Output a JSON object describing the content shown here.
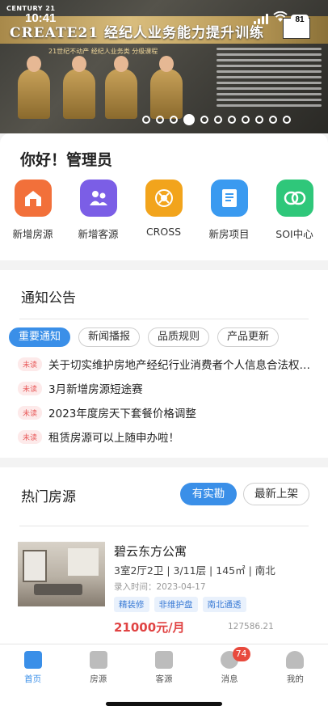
{
  "status": {
    "time": "10:41",
    "battery": "81"
  },
  "banner": {
    "brand": "CENTURY 21",
    "title": "CREATE21 经纪人业务能力提升训练",
    "subtitle": "21世纪不动产 经纪人业务类 分级课程",
    "slide_count": 11,
    "active_slide": 3
  },
  "greeting": "你好！管理员",
  "apps": [
    {
      "label": "新增房源",
      "icon": "house-add-icon",
      "color": "#f2703a"
    },
    {
      "label": "新增客源",
      "icon": "customer-add-icon",
      "color": "#7b5ee6"
    },
    {
      "label": "CROSS",
      "icon": "cross-icon",
      "color": "#f2a41c"
    },
    {
      "label": "新房项目",
      "icon": "new-project-icon",
      "color": "#3a9af0"
    },
    {
      "label": "SOI中心",
      "icon": "soi-center-icon",
      "color": "#2fc77a"
    }
  ],
  "notices": {
    "title": "通知公告",
    "tabs": [
      "重要通知",
      "新闻播报",
      "品质规则",
      "产品更新"
    ],
    "items": [
      {
        "badge": "未读",
        "text": "关于切实维护房地产经纪行业消费者个人信息合法权益的通知"
      },
      {
        "badge": "未读",
        "text": "3月新增房源短途赛"
      },
      {
        "badge": "未读",
        "text": "2023年度房天下套餐价格调整"
      },
      {
        "badge": "未读",
        "text": "租赁房源可以上随申办啦！"
      }
    ]
  },
  "hot": {
    "title": "热门房源",
    "filter_active": "有实勘",
    "filter_other": "最新上架",
    "listing": {
      "name": "碧云东方公寓",
      "detail": "3室2厅2卫 | 3/11层 | 145㎡ | 南北",
      "date": "录入时间：2023-04-17",
      "tags": [
        "精装修",
        "非维护盘",
        "南北通透"
      ],
      "price": "21000元/月",
      "unit_price": "127586.21"
    }
  },
  "nav": {
    "items": [
      {
        "label": "首页",
        "icon": "home-icon"
      },
      {
        "label": "房源",
        "icon": "listings-icon"
      },
      {
        "label": "客源",
        "icon": "clients-icon"
      },
      {
        "label": "消息",
        "icon": "message-icon",
        "badge": "74"
      },
      {
        "label": "我的",
        "icon": "profile-icon"
      }
    ],
    "active": "首页"
  }
}
